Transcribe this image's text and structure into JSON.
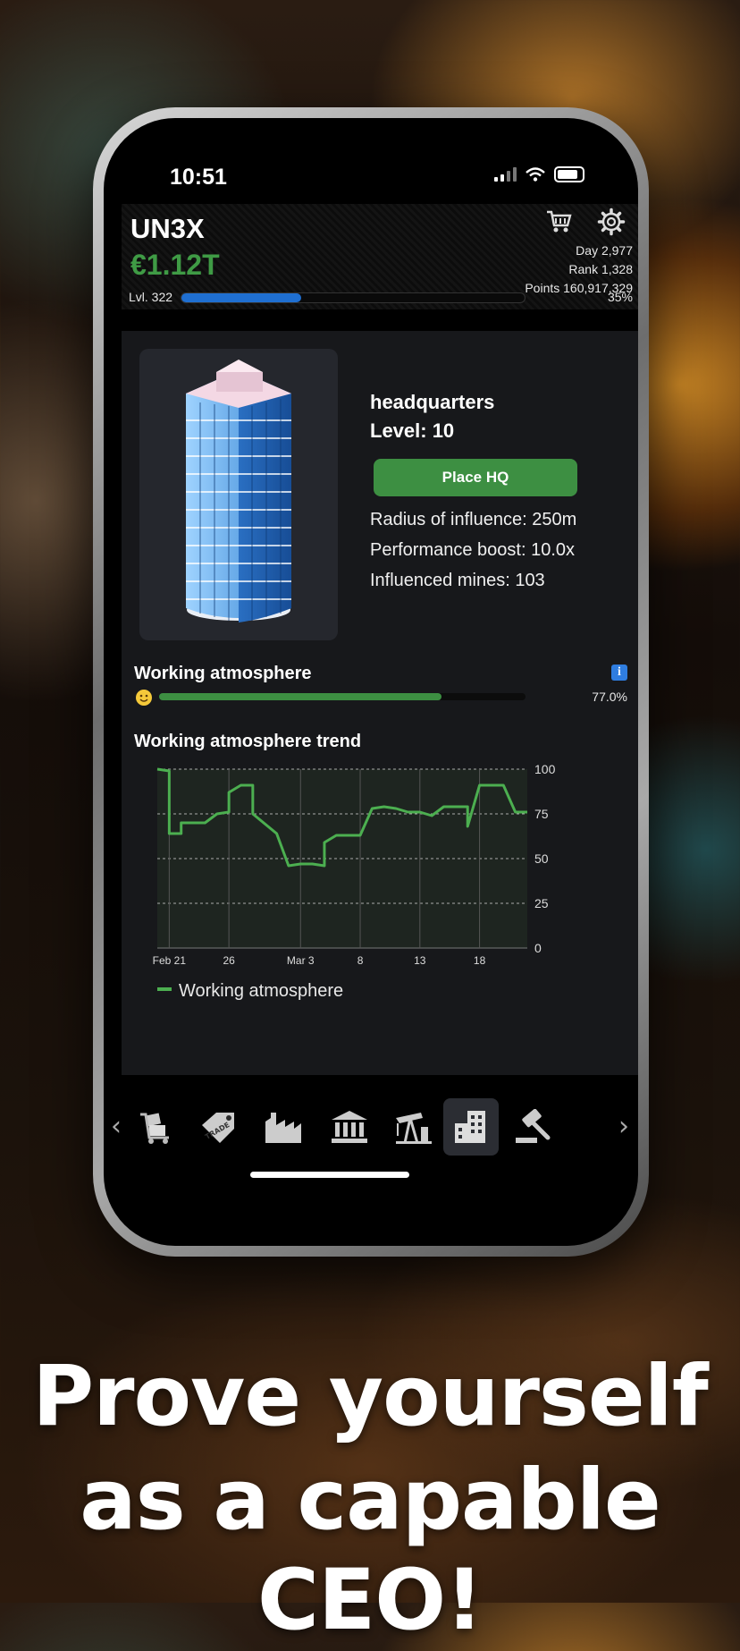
{
  "status_bar": {
    "time": "10:51"
  },
  "header": {
    "company": "UN3X",
    "money": "€1.12T",
    "day": "Day 2,977",
    "rank": "Rank 1,328",
    "points": "Points 160,917,329",
    "level": "Lvl. 322",
    "progress_percent": 35,
    "progress_label": "35%",
    "icons": [
      "cart-icon",
      "gear-icon"
    ]
  },
  "building": {
    "name": "headquarters",
    "level": "Level: 10",
    "place_button": "Place HQ",
    "radius": "Radius of influence: 250m",
    "boost": "Performance boost: 10.0x",
    "mines": "Influenced mines: 103"
  },
  "atmosphere": {
    "title": "Working atmosphere",
    "value_percent": 77.0,
    "value_label": "77.0%",
    "info_glyph": "i"
  },
  "trend": {
    "title": "Working atmosphere trend",
    "legend": "Working atmosphere"
  },
  "chart_data": {
    "type": "line",
    "title": "Working atmosphere trend",
    "x_tick_labels": [
      "Feb 21",
      "26",
      "Mar 3",
      "8",
      "13",
      "18"
    ],
    "y_tick_labels": [
      "100",
      "75",
      "50",
      "25",
      "0"
    ],
    "ylim": [
      0,
      100
    ],
    "grid": true,
    "legend_position": "bottom-left",
    "series": [
      {
        "name": "Working atmosphere",
        "color": "#4caf50",
        "points": [
          {
            "x": "Feb 20",
            "y": 100
          },
          {
            "x": "Feb 21",
            "y": 99
          },
          {
            "x": "Feb 21",
            "y": 64
          },
          {
            "x": "Feb 22",
            "y": 64
          },
          {
            "x": "Feb 22",
            "y": 70
          },
          {
            "x": "Feb 23",
            "y": 70
          },
          {
            "x": "Feb 24",
            "y": 70
          },
          {
            "x": "Feb 25",
            "y": 75
          },
          {
            "x": "Feb 26",
            "y": 76
          },
          {
            "x": "Feb 26",
            "y": 87
          },
          {
            "x": "Feb 27",
            "y": 91
          },
          {
            "x": "Feb 28",
            "y": 91
          },
          {
            "x": "Feb 28",
            "y": 75
          },
          {
            "x": "Mar 1",
            "y": 64
          },
          {
            "x": "Mar 2",
            "y": 46
          },
          {
            "x": "Mar 3",
            "y": 47
          },
          {
            "x": "Mar 4",
            "y": 47
          },
          {
            "x": "Mar 5",
            "y": 46
          },
          {
            "x": "Mar 5",
            "y": 59
          },
          {
            "x": "Mar 6",
            "y": 63
          },
          {
            "x": "Mar 7",
            "y": 63
          },
          {
            "x": "Mar 8",
            "y": 63
          },
          {
            "x": "Mar 9",
            "y": 78
          },
          {
            "x": "Mar 10",
            "y": 79
          },
          {
            "x": "Mar 11",
            "y": 78
          },
          {
            "x": "Mar 12",
            "y": 76
          },
          {
            "x": "Mar 13",
            "y": 76
          },
          {
            "x": "Mar 14",
            "y": 74
          },
          {
            "x": "Mar 15",
            "y": 79
          },
          {
            "x": "Mar 16",
            "y": 79
          },
          {
            "x": "Mar 17",
            "y": 79
          },
          {
            "x": "Mar 17",
            "y": 68
          },
          {
            "x": "Mar 18",
            "y": 91
          },
          {
            "x": "Mar 19",
            "y": 91
          },
          {
            "x": "Mar 20",
            "y": 91
          },
          {
            "x": "Mar 21",
            "y": 76
          },
          {
            "x": "Mar 22",
            "y": 76
          }
        ]
      }
    ]
  },
  "nav": {
    "items": [
      {
        "name": "nav-logistics-icon",
        "active": false
      },
      {
        "name": "nav-trade-icon",
        "active": false,
        "label": "TRADE"
      },
      {
        "name": "nav-factory-icon",
        "active": false
      },
      {
        "name": "nav-bank-icon",
        "active": false
      },
      {
        "name": "nav-oil-pump-icon",
        "active": false
      },
      {
        "name": "nav-headquarters-icon",
        "active": true
      },
      {
        "name": "nav-auction-icon",
        "active": false
      }
    ],
    "prev_glyph": "‹",
    "next_glyph": "›"
  },
  "caption": {
    "line1": "Prove yourself",
    "line2": "as a capable CEO!"
  }
}
